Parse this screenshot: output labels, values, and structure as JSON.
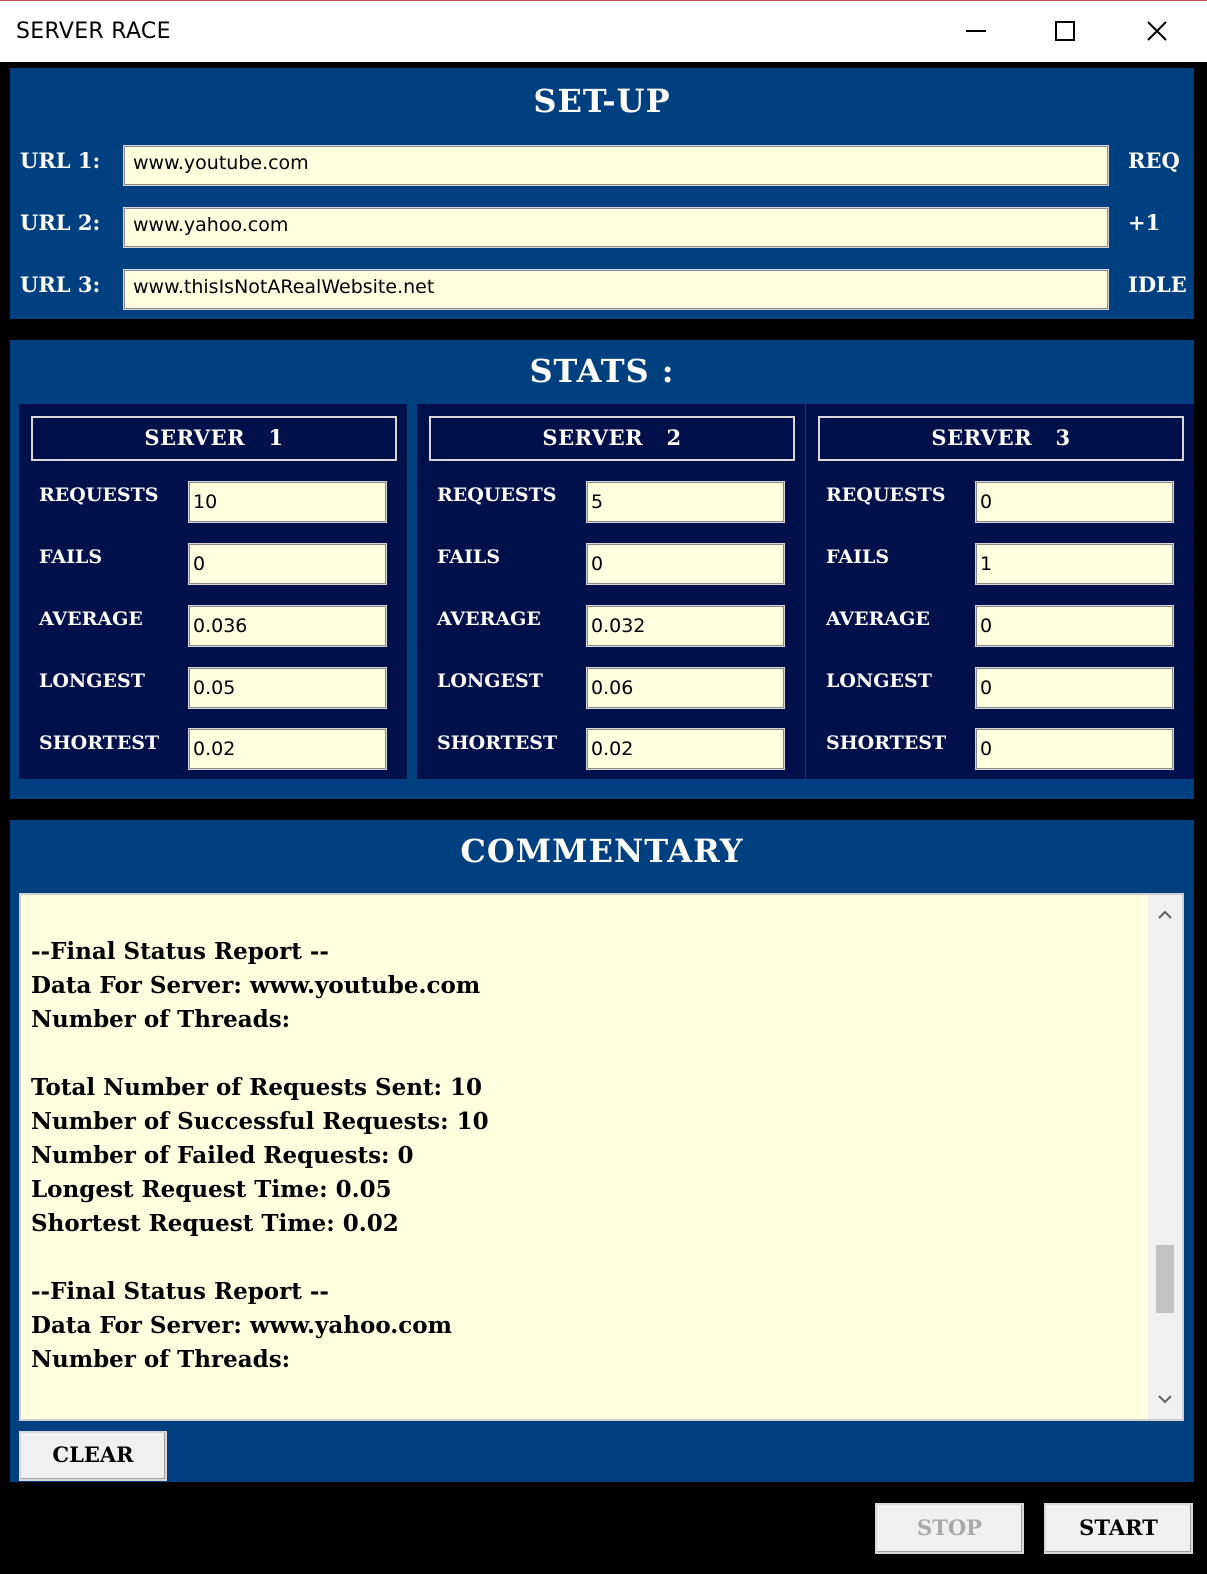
{
  "window": {
    "title": "SERVER RACE"
  },
  "setup": {
    "heading": "SET-UP",
    "rows": [
      {
        "label": "URL 1:",
        "value": "www.youtube.com",
        "status": "REQ"
      },
      {
        "label": "URL 2:",
        "value": "www.yahoo.com",
        "status": "+1"
      },
      {
        "label": "URL 3:",
        "value": "www.thisIsNotARealWebsite.net",
        "status": "IDLE"
      }
    ]
  },
  "stats": {
    "heading": "STATS :",
    "labels": {
      "requests": "REQUESTS",
      "fails": "FAILS",
      "average": "AVERAGE",
      "longest": "LONGEST",
      "shortest": "SHORTEST"
    },
    "servers": [
      {
        "title": "SERVER   1",
        "requests": "10",
        "fails": "0",
        "average": "0.036",
        "longest": "0.05",
        "shortest": "0.02"
      },
      {
        "title": "SERVER   2",
        "requests": "5",
        "fails": "0",
        "average": "0.032",
        "longest": "0.06",
        "shortest": "0.02"
      },
      {
        "title": "SERVER   3",
        "requests": "0",
        "fails": "1",
        "average": "0",
        "longest": "0",
        "shortest": "0"
      }
    ]
  },
  "commentary": {
    "heading": "COMMENTARY",
    "lines": [
      "--Final Status Report --",
      "Data For Server: www.youtube.com",
      "Number of Threads:",
      "",
      "Total Number of Requests Sent: 10",
      "Number of Successful Requests: 10",
      "Number of Failed Requests: 0",
      "Longest Request Time: 0.05",
      "Shortest Request Time: 0.02",
      "",
      "--Final Status Report --",
      "Data For Server: www.yahoo.com",
      "Number of Threads:"
    ],
    "clear_label": "CLEAR"
  },
  "controls": {
    "stop_label": "STOP",
    "start_label": "START"
  },
  "icons": {
    "scroll_up": "chevron-up-icon",
    "scroll_down": "chevron-down-icon"
  },
  "colors": {
    "panel": "#003f80",
    "server_box": "#00104a",
    "field_bg": "#ffffe0"
  }
}
